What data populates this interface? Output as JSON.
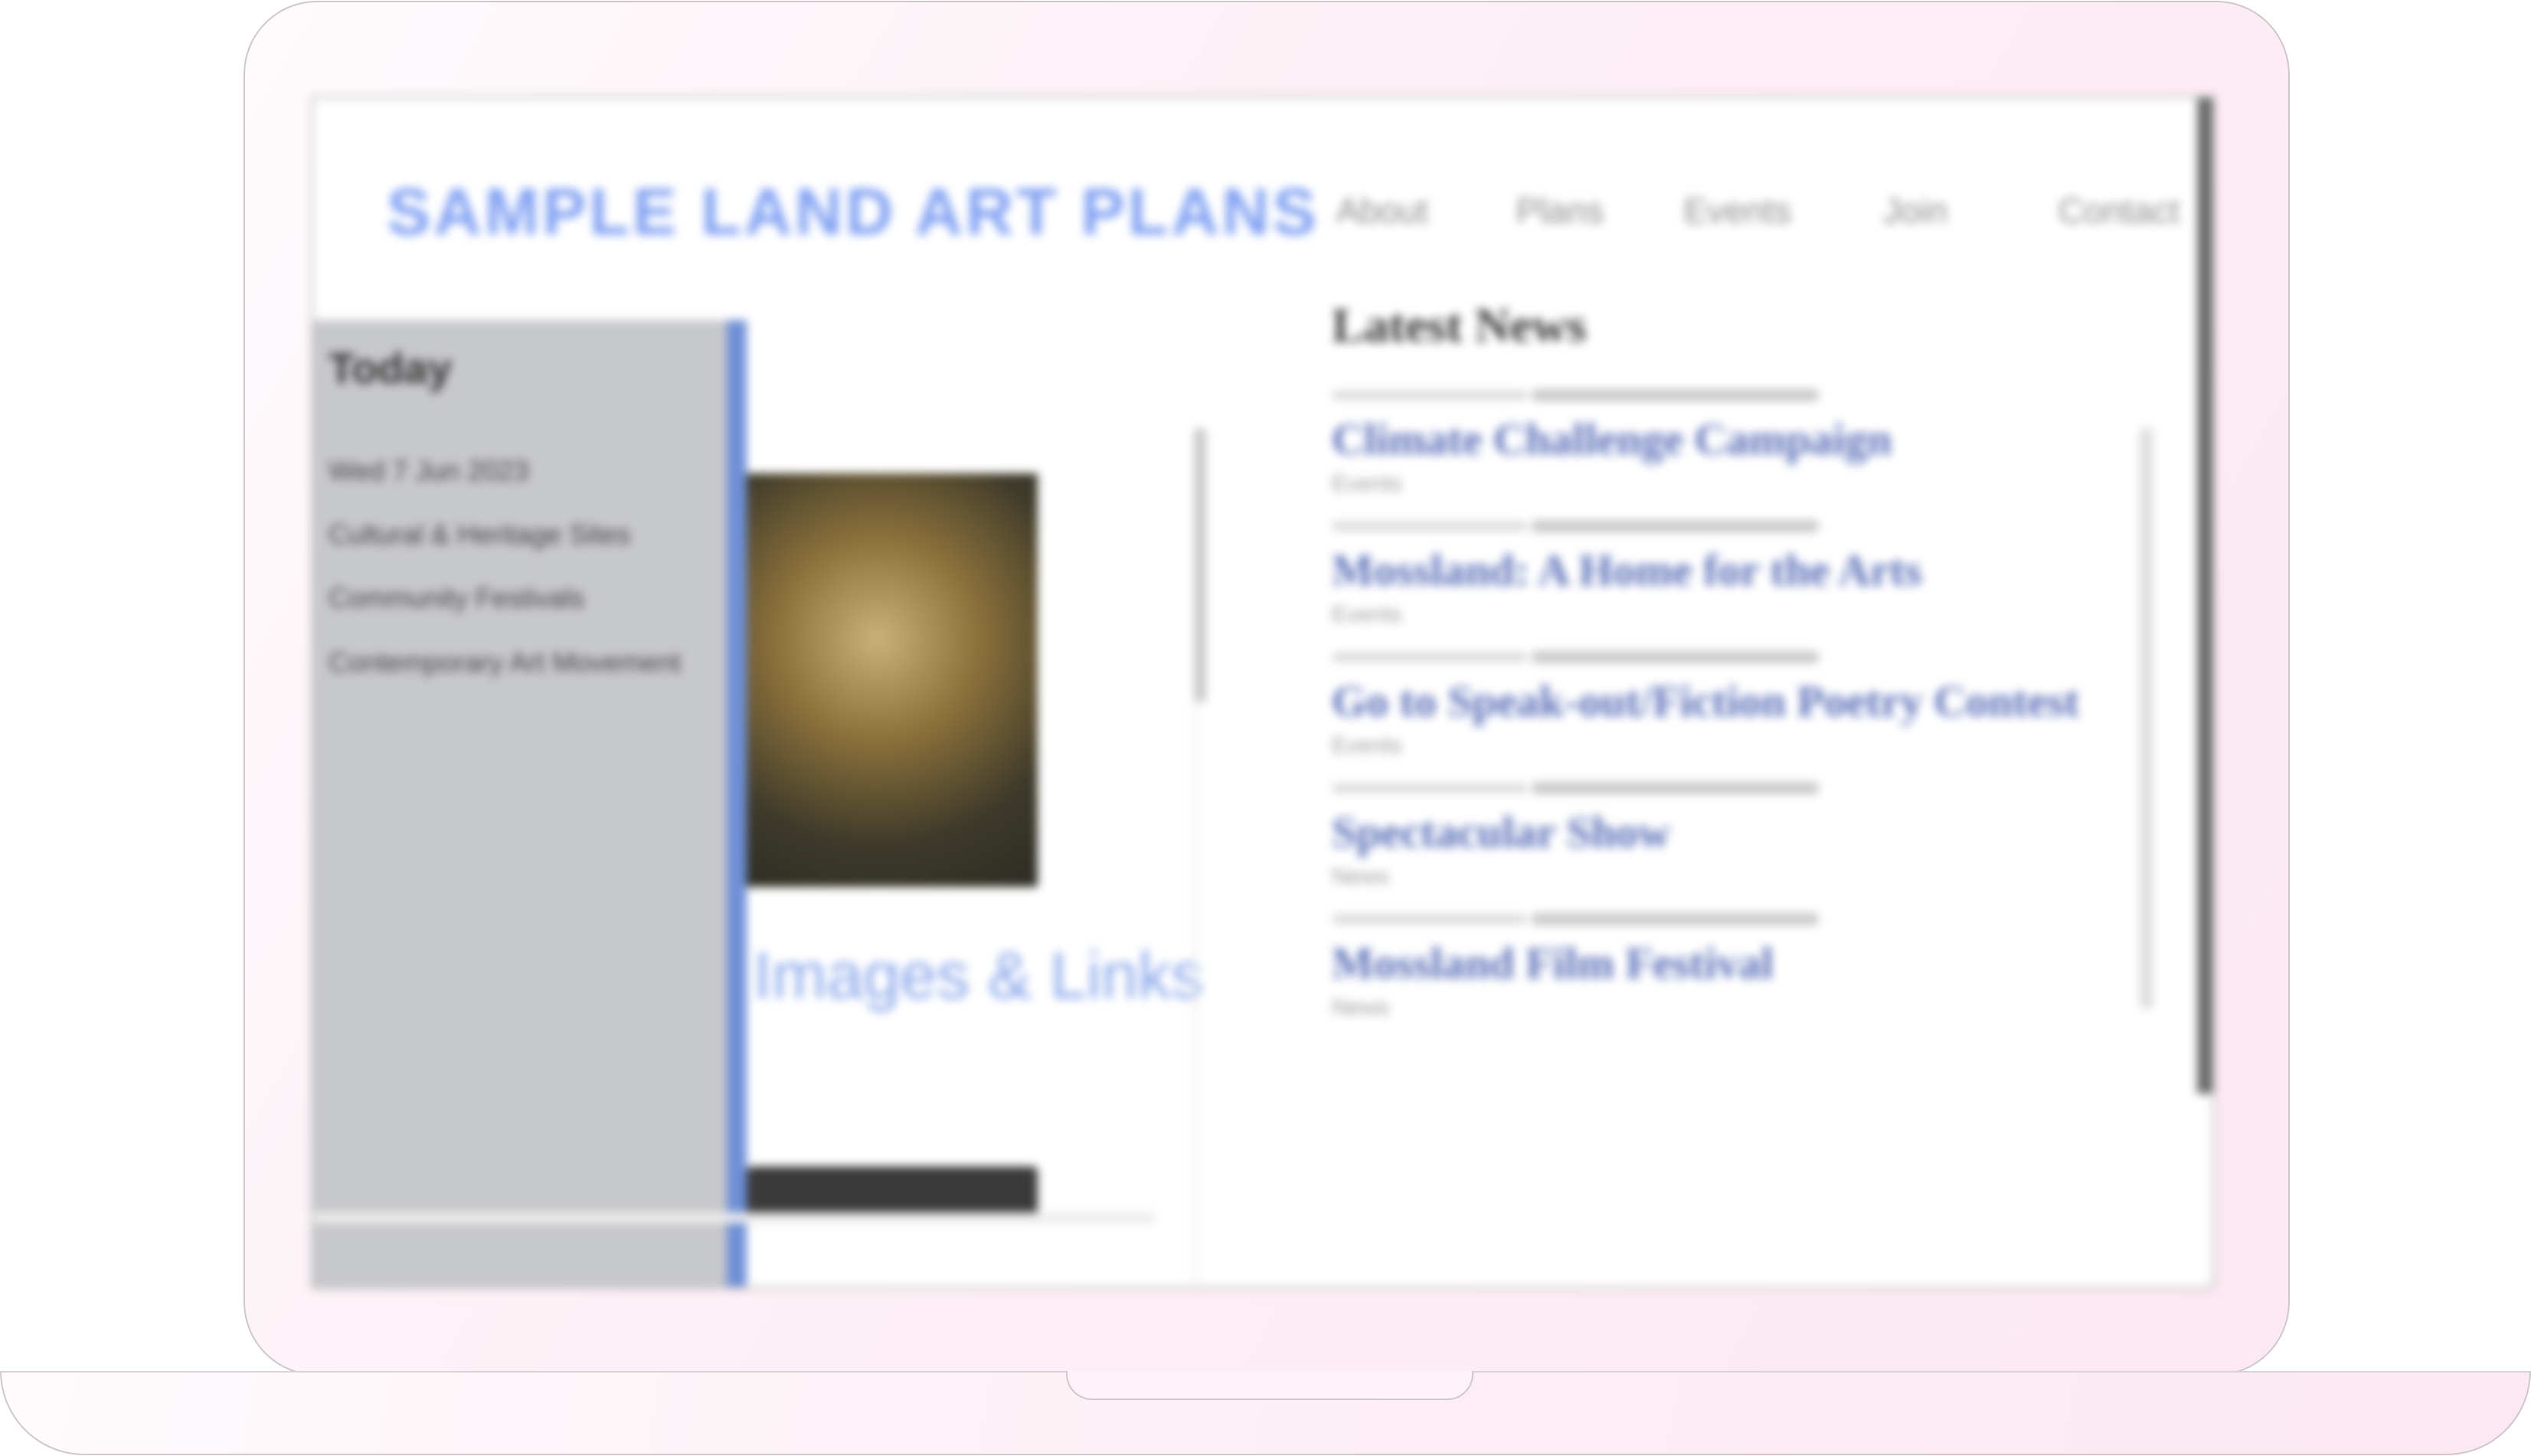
{
  "site": {
    "logo": "SAMPLE LAND ART PLANS"
  },
  "nav": {
    "items": [
      "About",
      "Plans",
      "Events",
      "Join",
      "Contact"
    ]
  },
  "left_panel": {
    "title": "Today",
    "items": [
      "Wed 7 Jun 2023",
      "",
      "Cultural & Heritage Sites",
      "Community Festivals",
      "",
      "Contemporary Art Movement",
      "",
      ""
    ]
  },
  "feature": {
    "title": "Images & Links"
  },
  "news": {
    "title": "Latest News",
    "items": [
      {
        "title": "Climate Challenge Campaign",
        "tag": "Events"
      },
      {
        "title": "Mossland: A Home for the Arts",
        "tag": "Events"
      },
      {
        "title": "Go to Speak-out/Fiction Poetry Contest",
        "tag": "Events"
      },
      {
        "title": "Spectacular Show",
        "tag": "News"
      },
      {
        "title": "Mossland Film Festival",
        "tag": "News"
      }
    ]
  },
  "colors": {
    "logo": "#7e9ff2",
    "link": "#5a6fb8",
    "panel_bg": "#c7c8cb",
    "accent_bar": "#6f8fd6"
  }
}
